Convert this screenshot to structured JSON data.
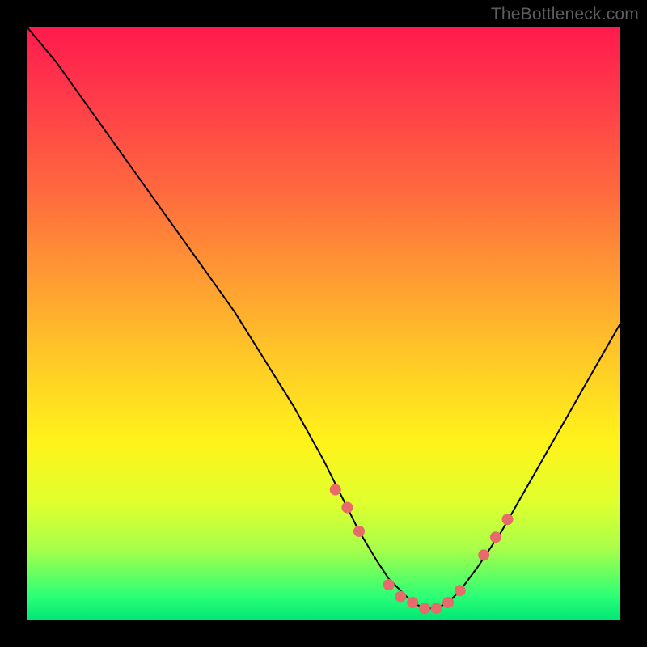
{
  "watermark": "TheBottleneck.com",
  "colors": {
    "background_frame": "#000000",
    "gradient_top": "#ff1a4d",
    "gradient_bottom": "#00e676",
    "curve_stroke": "#000000",
    "marker_fill": "#e96a6a"
  },
  "chart_data": {
    "type": "line",
    "title": "",
    "xlabel": "",
    "ylabel": "",
    "xlim": [
      0,
      100
    ],
    "ylim": [
      0,
      100
    ],
    "grid": false,
    "legend": false,
    "series": [
      {
        "name": "curve",
        "x": [
          0,
          5,
          10,
          15,
          20,
          25,
          30,
          35,
          40,
          45,
          50,
          53,
          56,
          59,
          61,
          63,
          65,
          67,
          69,
          71,
          73,
          76,
          80,
          84,
          88,
          92,
          96,
          100
        ],
        "y": [
          100,
          94,
          87,
          80,
          73,
          66,
          59,
          52,
          44,
          36,
          27,
          21,
          15,
          10,
          7,
          5,
          3,
          2,
          2,
          3,
          5,
          9,
          15,
          22,
          29,
          36,
          43,
          50
        ]
      }
    ],
    "markers": {
      "name": "highlighted-points",
      "x": [
        52,
        54,
        56,
        61,
        63,
        65,
        67,
        69,
        71,
        73,
        77,
        79,
        81
      ],
      "y": [
        22,
        19,
        15,
        6,
        4,
        3,
        2,
        2,
        3,
        5,
        11,
        14,
        17
      ]
    }
  }
}
